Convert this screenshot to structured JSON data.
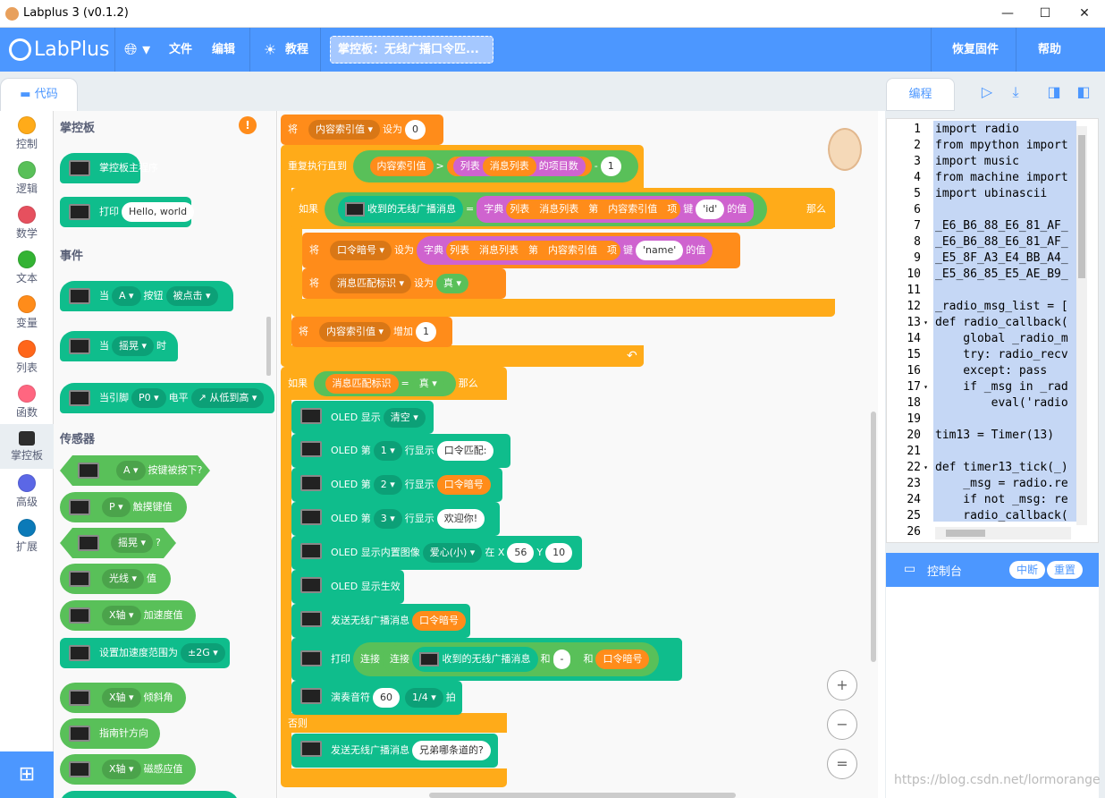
{
  "window": {
    "title": "Labplus 3 (v0.1.2)",
    "minimize": "—",
    "maximize": "☐",
    "close": "✕"
  },
  "menu": {
    "logo": "LabPlus",
    "file": "文件",
    "edit": "编辑",
    "tutorial": "教程",
    "project": "掌控板：无线广播口令匹...",
    "restore": "恢复固件",
    "help": "帮助",
    "language_icon": "globe-icon",
    "tutorial_icon": "lightbulb-icon"
  },
  "tabs": {
    "code": "代码"
  },
  "categories": [
    {
      "label": "控制",
      "color": "#ffab19"
    },
    {
      "label": "逻辑",
      "color": "#59c059"
    },
    {
      "label": "数学",
      "color": "#e6505e"
    },
    {
      "label": "文本",
      "color": "#33b333"
    },
    {
      "label": "变量",
      "color": "#ff8c1a"
    },
    {
      "label": "列表",
      "color": "#ff661a"
    },
    {
      "label": "函数",
      "color": "#ff6680"
    },
    {
      "label": "掌控板",
      "color": "#2e2e2e"
    },
    {
      "label": "高级",
      "color": "#5b67e6"
    },
    {
      "label": "扩展",
      "color": "#0b7ab8"
    }
  ],
  "flyout": {
    "sec_board": "掌控板",
    "b_main": "掌控板主程序",
    "b_print": "打印",
    "b_print_val": "Hello, world",
    "sec_events": "事件",
    "e_when": "当",
    "e_a": "A ▾",
    "e_button": "按钮",
    "e_clicked": "被点击 ▾",
    "e_shake": "摇晃 ▾",
    "e_time": "时",
    "e_pin": "当引脚",
    "e_p0": "P0 ▾",
    "e_level": "电平",
    "e_edge": "↗ 从低到高 ▾",
    "sec_sensors": "传感器",
    "s_pressed": "按键被按下?",
    "s_p": "P ▾",
    "s_touch": "触摸键值",
    "s_shake": "摇晃 ▾",
    "s_q": "?",
    "s_light": "光线 ▾",
    "s_val": "值",
    "s_x": "X轴 ▾",
    "s_accel": "加速度值",
    "s_setrange": "设置加速度范围为",
    "s_2g": "±2G ▾",
    "s_tilt": "倾斜角",
    "s_compass": "指南针方向",
    "s_mag": "磁感应值",
    "warn": "!"
  },
  "ws": {
    "set": "将",
    "to": "设为",
    "idx": "内容索引值 ▾",
    "zero": "0",
    "repeat_until": "重复执行直到",
    "idx_r": "内容索引值",
    "gt": ">",
    "list": "列表",
    "msglist": "消息列表",
    "count": "的项目数",
    "minus": "-",
    "one": "1",
    "if": "如果",
    "recv": "收到的无线广播消息",
    "eq": "=",
    "dict": "字典",
    "nth": "第",
    "item": "项",
    "key": "键",
    "id": "'id'",
    "val_of": "的值",
    "then": "那么",
    "cmd": "口令暗号 ▾",
    "name": "'name'",
    "flag": "消息匹配标识 ▾",
    "true": "真 ▾",
    "inc": "增加",
    "flag_r": "消息匹配标识",
    "oled_show": "OLED 显示",
    "clear": "清空 ▾",
    "oled_nth": "OLED 第",
    "l1": "1 ▾",
    "l2": "2 ▾",
    "l3": "3 ▾",
    "line_show": "行显示",
    "t1": "口令匹配:",
    "cmd_r": "口令暗号",
    "t3": "欢迎你!",
    "oled_img": "OLED 显示内置图像",
    "heart": "爱心(小) ▾",
    "atx": "在 X",
    "x56": "56",
    "y": "Y",
    "y10": "10",
    "oled_apply": "OLED 显示生效",
    "send": "发送无线广播消息",
    "print": "打印",
    "join": "连接",
    "and": "和",
    "dash": "-",
    "note": "演奏音符",
    "n60": "60",
    "q": "1/4 ▾",
    "beat": "拍",
    "else": "否则",
    "brother": "兄弟哪条道的?",
    "undo": "↶"
  },
  "zoom": {
    "in": "+",
    "out": "−",
    "reset": "="
  },
  "right": {
    "tab": "编程",
    "run_icon": "play-icon",
    "download_icon": "download-icon",
    "layout1_icon": "layout-icon",
    "layout2_icon": "split-icon"
  },
  "code": {
    "lines": [
      "1",
      "2",
      "3",
      "4",
      "5",
      "6",
      "7",
      "8",
      "9",
      "10",
      "11",
      "12",
      "13",
      "14",
      "15",
      "16",
      "17",
      "18",
      "19",
      "20",
      "21",
      "22",
      "23",
      "24",
      "25",
      "26"
    ],
    "text": [
      "import radio",
      "from mpython import",
      "import music",
      "from machine import",
      "import ubinascii",
      "",
      "_E6_B6_88_E6_81_AF_",
      "_E6_B6_88_E6_81_AF_",
      "_E5_8F_A3_E4_BB_A4_",
      "_E5_86_85_E5_AE_B9_",
      "",
      "_radio_msg_list = [",
      "def radio_callback(",
      "    global _radio_m",
      "    try: radio_recv",
      "    except: pass",
      "    if _msg in _rad",
      "        eval('radio",
      "",
      "tim13 = Timer(13)",
      "",
      "def timer13_tick(_)",
      "    _msg = radio.re",
      "    if not _msg: re",
      "    radio_callback(",
      ""
    ]
  },
  "console": {
    "title": "控制台",
    "interrupt": "中断",
    "reset": "重置"
  },
  "watermark": "https://blog.csdn.net/lormorange"
}
